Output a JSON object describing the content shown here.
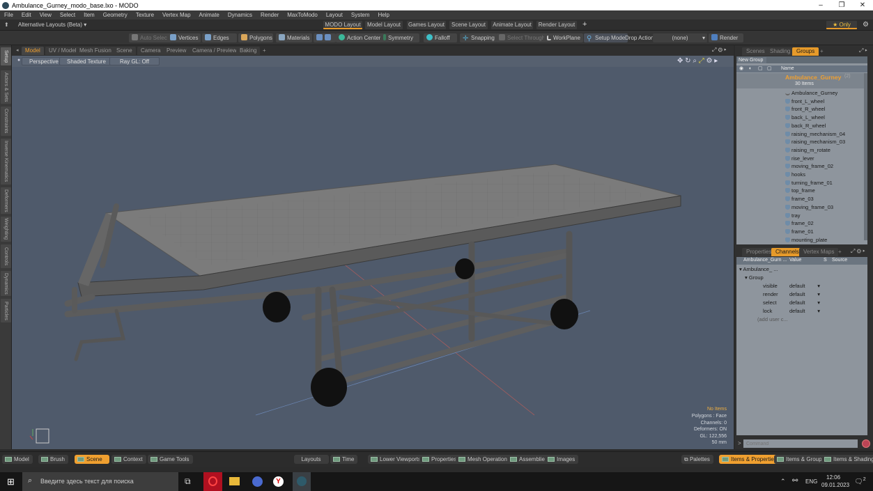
{
  "window": {
    "title": "Ambulance_Gurney_modo_base.lxo - MODO",
    "controls": [
      "–",
      "❐",
      "✕"
    ]
  },
  "menu": [
    "File",
    "Edit",
    "View",
    "Select",
    "Item",
    "Geometry",
    "Texture",
    "Vertex Map",
    "Animate",
    "Dynamics",
    "Render",
    "MaxToModo",
    "Layout",
    "System",
    "Help"
  ],
  "layoutbar": {
    "alt_layouts": "Alternative Layouts (Beta) ▾",
    "tabs": [
      "MODO Layout",
      "Model Layout",
      "Games Layout",
      "Scene Layout",
      "Animate Layout",
      "Render Layout"
    ],
    "add": "+",
    "only": "★ Only"
  },
  "toolbar": {
    "auto_select": "Auto Select",
    "vertices": "Vertices",
    "edges": "Edges",
    "polygons": "Polygons",
    "materials": "Materials",
    "action_center": "Action Center",
    "symmetry": "Symmetry",
    "falloff": "Falloff",
    "snapping": "Snapping",
    "select_through": "Select Through",
    "workplane": "WorkPlane",
    "setup_mode": "Setup Mode",
    "drop_action_label": "Drop Action",
    "drop_action_value": "(none)",
    "render": "Render"
  },
  "left_tabs": [
    "Setup",
    "Actors & Sets",
    "Constraints",
    "Inverse Kinematics",
    "Deformers",
    "Weighting",
    "Controls",
    "Dynamics",
    "Particles"
  ],
  "viewport_tabs": [
    "Model",
    "UV / Model",
    "Mesh Fusion",
    "Scene",
    "Camera",
    "Preview",
    "Camera / Preview",
    "Baking",
    "+"
  ],
  "viewport": {
    "view": "Perspective",
    "shading": "Shaded Texture",
    "raygl": "Ray GL: Off",
    "info": {
      "items": "No Items",
      "polygons": "Polygons : Face",
      "channels": "Channels: 0",
      "deformers": "Deformers: ON",
      "gl": "GL: 122,556",
      "unit": "50 mm"
    }
  },
  "right_top_tabs": [
    "Scenes",
    "Shading",
    "Groups",
    "+"
  ],
  "groups": {
    "new_group": "New Group",
    "name_header": "Name",
    "root": "Ambulance_Gurney",
    "root_suffix": "(2)",
    "count": "30 Items",
    "items": [
      "Ambulance_Gurney",
      "front_L_wheel",
      "front_R_wheel",
      "back_L_wheel",
      "back_R_wheel",
      "raising_mechanism_04",
      "raising_mechanism_03",
      "raising_m_rotate",
      "rise_lever",
      "moving_frame_02",
      "hooks",
      "turning_frame_01",
      "top_frame",
      "frame_03",
      "moving_frame_03",
      "tray",
      "frame_02",
      "frame_01",
      "mounting_plate"
    ]
  },
  "right_bottom_tabs": [
    "Properties",
    "Channels",
    "Vertex Maps",
    "+"
  ],
  "channels": {
    "headers": [
      "Ambulance_Gurn ...",
      "Value",
      "S",
      "Source"
    ],
    "root": "Ambulance_ ...",
    "group": "Group",
    "rows": [
      {
        "name": "visible",
        "value": "default"
      },
      {
        "name": "render",
        "value": "default"
      },
      {
        "name": "select",
        "value": "default"
      },
      {
        "name": "lock",
        "value": "default"
      }
    ],
    "add_user": "(add user c..."
  },
  "command": {
    "prompt": ">",
    "placeholder": "Command"
  },
  "bottombar": {
    "left": [
      "Model",
      "Brush",
      "Scene",
      "Context",
      "Game Tools"
    ],
    "center": [
      "Layouts",
      "Time",
      "Lower Viewports",
      "Properties",
      "Mesh Operations",
      "Assemblies",
      "Images"
    ],
    "right": [
      "Palettes",
      "Items & Properties",
      "Items & Groups",
      "Items & Shading"
    ]
  },
  "taskbar": {
    "search_placeholder": "Введите здесь текст для поиска",
    "lang": "ENG",
    "time": "12:06",
    "date": "09.01.2023",
    "notifications": "2"
  }
}
